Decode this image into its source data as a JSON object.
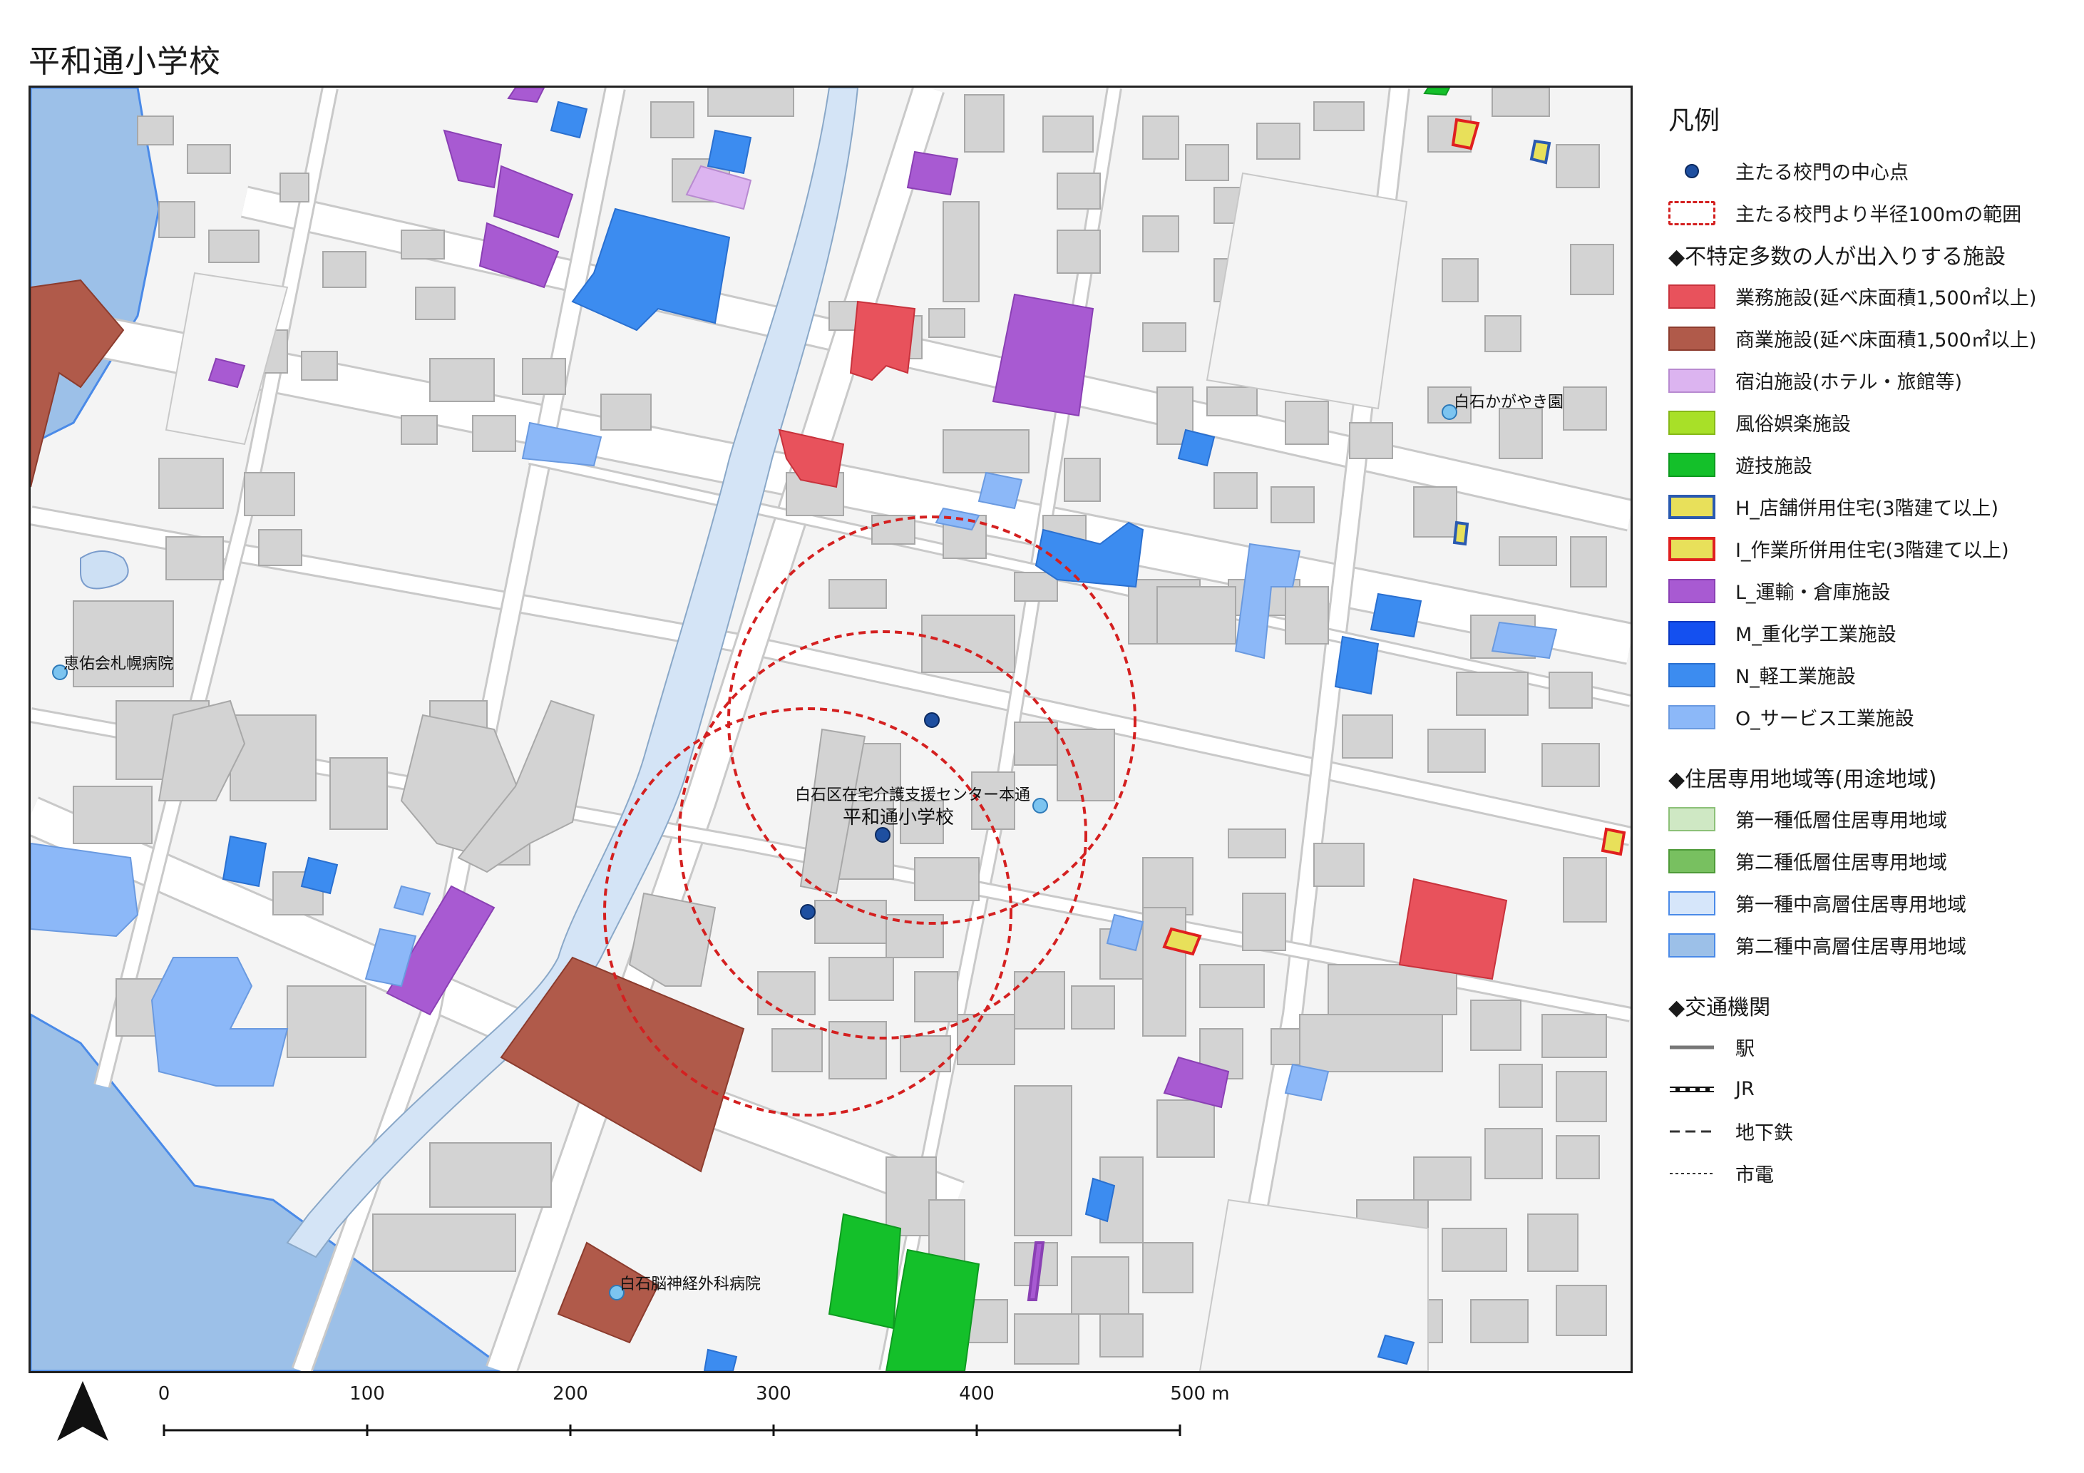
{
  "title": "平和通小学校",
  "map": {
    "labels": {
      "school_name": "平和通小学校",
      "care_center": "白石区在宅介護支援センター本通",
      "kagayaki": "白石かがやき園",
      "hospital_keiyu": "恵佑会札幌病院",
      "hospital_neuro": "白石脳神経外科病院"
    },
    "school_gate_points": 3
  },
  "legend": {
    "title": "凡例",
    "gate_point": "主たる校門の中心点",
    "radius_range": "主たる校門より半径100mの範囲",
    "facilities_heading": "◆不特定多数の人が出入りする施設",
    "facilities": [
      {
        "label": "業務施設(延べ床面積1,500㎡以上)",
        "color": "#e8525c",
        "border": "#c8323c"
      },
      {
        "label": "商業施設(延べ床面積1,500㎡以上)",
        "color": "#b05a4a",
        "border": "#8c3c2e"
      },
      {
        "label": "宿泊施設(ホテル・旅館等)",
        "color": "#dcb4f0",
        "border": "#b88ad0"
      },
      {
        "label": "風俗娯楽施設",
        "color": "#a8e028",
        "border": "#86b818"
      },
      {
        "label": "遊技施設",
        "color": "#14c02a",
        "border": "#0e9a20"
      },
      {
        "label": "H_店舗併用住宅(3階建て以上)",
        "color": "#e8e05a",
        "border": "#2a5ab0"
      },
      {
        "label": "I_作業所併用住宅(3階建て以上)",
        "color": "#e8e05a",
        "border": "#e02020"
      },
      {
        "label": "L_運輸・倉庫施設",
        "color": "#a85ad2",
        "border": "#8a40b4"
      },
      {
        "label": "M_重化学工業施設",
        "color": "#1450f0",
        "border": "#0a38c0"
      },
      {
        "label": "N_軽工業施設",
        "color": "#3c8cf0",
        "border": "#2a70d0"
      },
      {
        "label": "O_サービス工業施設",
        "color": "#8cb8f8",
        "border": "#6a9ae0"
      }
    ],
    "zones_heading": "◆住居専用地域等(用途地域)",
    "zones": [
      {
        "label": "第一種低層住居専用地域",
        "color": "#cfe8c4",
        "border": "#8cc078"
      },
      {
        "label": "第二種低層住居専用地域",
        "color": "#78c060",
        "border": "#4e9a38"
      },
      {
        "label": "第一種中高層住居専用地域",
        "color": "#d6e6fa",
        "border": "#4a8ae8"
      },
      {
        "label": "第二種中高層住居専用地域",
        "color": "#9cc0e8",
        "border": "#4a8ae8"
      }
    ],
    "transport_heading": "◆交通機関",
    "transport": [
      {
        "label": "駅",
        "style": "solid-gray"
      },
      {
        "label": "JR",
        "style": "rail"
      },
      {
        "label": "地下鉄",
        "style": "dashed"
      },
      {
        "label": "市電",
        "style": "dotted"
      }
    ]
  },
  "scale": {
    "ticks": [
      "0",
      "100",
      "200",
      "300",
      "400",
      "500 m"
    ]
  },
  "colors": {
    "gate_point": "#1e4fa0",
    "radius_circle": "#d42020",
    "poi": "#7cc4f0",
    "river": "#d4e4f6"
  }
}
